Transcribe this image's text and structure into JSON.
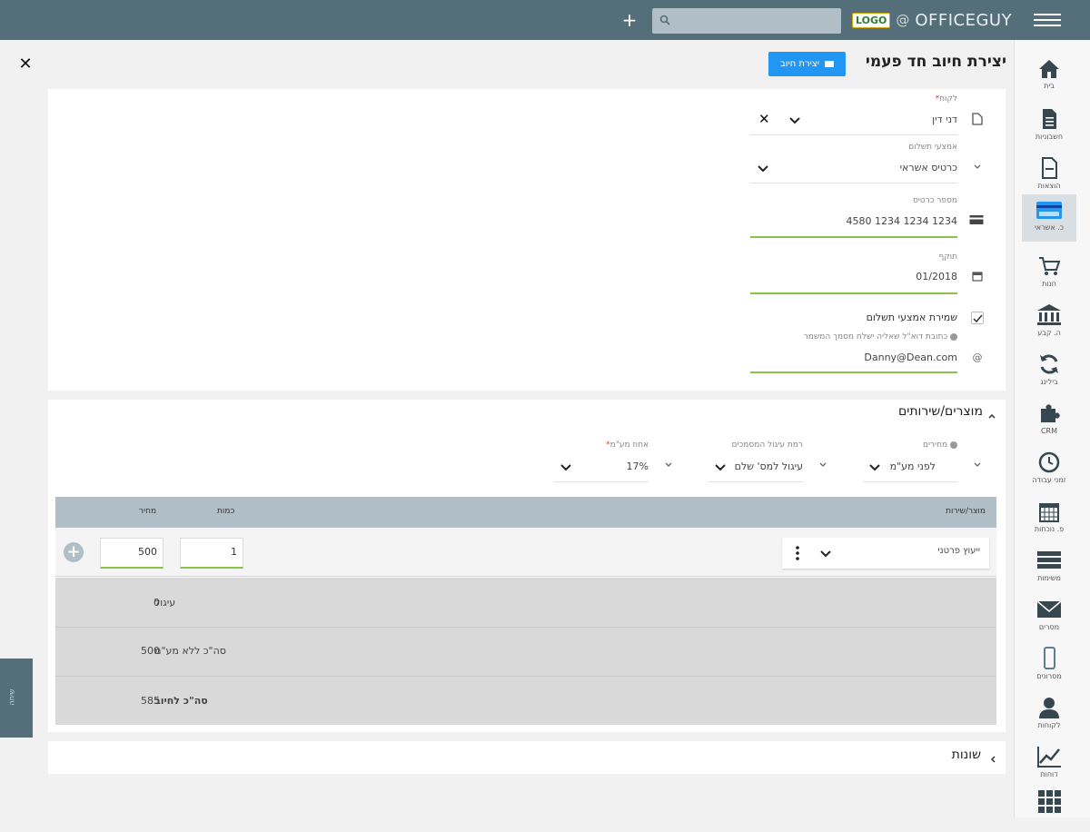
{
  "topbar": {
    "brand_badge": "LOGO",
    "brand_at": "@",
    "brand_name": "OFFICEGUY",
    "search_placeholder": "",
    "add_label": "+"
  },
  "sidebar": {
    "items": [
      {
        "label": "בית",
        "icon": "home-icon"
      },
      {
        "label": "חשבוניות",
        "icon": "invoice-icon"
      },
      {
        "label": "הוצאות",
        "icon": "expense-icon"
      },
      {
        "label": "כ. אשראי",
        "icon": "credit-card-icon",
        "active": true
      },
      {
        "label": "חנות",
        "icon": "cart-icon"
      },
      {
        "label": "ה. קבע",
        "icon": "bank-icon"
      },
      {
        "label": "בילינג",
        "icon": "billing-icon"
      },
      {
        "label": "CRM",
        "icon": "puzzle-icon"
      },
      {
        "label": "זמני עבודה",
        "icon": "clock-icon"
      },
      {
        "label": "פ. נוכחות",
        "icon": "calendar-icon"
      },
      {
        "label": "משימות",
        "icon": "tasks-icon"
      },
      {
        "label": "מסרים",
        "icon": "mail-icon"
      },
      {
        "label": "מסרונים",
        "icon": "sms-icon"
      },
      {
        "label": "לקוחות",
        "icon": "customers-icon"
      },
      {
        "label": "דוחות",
        "icon": "reports-icon"
      },
      {
        "label": "",
        "icon": "apps-icon"
      }
    ]
  },
  "header": {
    "title": "יצירת חיוב חד פעמי",
    "create_button": "יצירת חיוב",
    "close": "✕"
  },
  "form": {
    "customer_label": "לקוח",
    "customer_required": "*",
    "customer_value": "דני דין",
    "payment_method_label": "אמצעי תשלום",
    "payment_method_value": "כרטיס אשראי",
    "card_number_label": "מספר כרטיס",
    "card_number_value": "4580 1234 1234 1234",
    "expiry_label": "תוקף",
    "expiry_value": "01/2018",
    "save_payment_label": "שמירת אמצעי תשלום",
    "email_hint": "כתובת דוא\"ל שאליה ישלח מסמך המשמר",
    "email_value": "Danny@Dean.com"
  },
  "products": {
    "title": "מוצרים/שירותים",
    "prices_label": "מחירים",
    "prices_value": "לפני מע\"מ",
    "rounding_label": "רמת עיגול המסמכים",
    "rounding_value": "עיגול למס' שלם",
    "vat_label": "אחוז מע\"מ",
    "vat_required": "*",
    "vat_value": "17%",
    "columns": {
      "product": "מוצר/שירות",
      "quantity": "כמות",
      "price": "מחיר"
    },
    "row": {
      "product": "ייעוץ פרטני",
      "quantity": "1",
      "price": "500"
    },
    "summary": [
      {
        "label": "עיגול",
        "value": "0"
      },
      {
        "label": "סה\"כ ללא מע\"מ",
        "value": "500"
      },
      {
        "label": "סה\"כ לחיוב",
        "value": "585"
      }
    ]
  },
  "notes": {
    "title": "שונות"
  },
  "side_tab": {
    "label": "שיחה"
  }
}
